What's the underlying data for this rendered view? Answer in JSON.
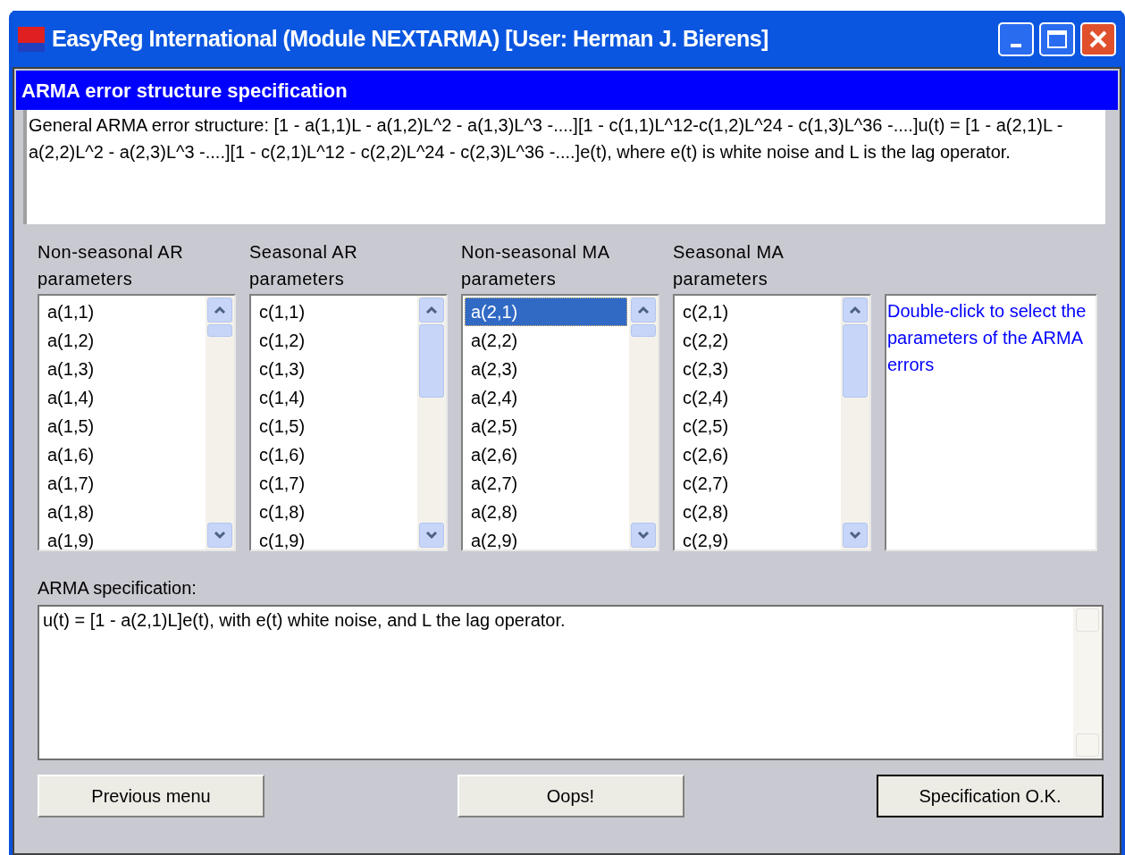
{
  "window": {
    "title": "EasyReg International (Module NEXTARMA) [User: Herman J. Bierens]"
  },
  "header": "ARMA error structure specification",
  "description": "General ARMA error structure: [1 - a(1,1)L - a(1,2)L^2 - a(1,3)L^3 -....][1 - c(1,1)L^12-c(1,2)L^24 - c(1,3)L^36 -....]u(t) = [1 - a(2,1)L - a(2,2)L^2 - a(2,3)L^3 -....][1 - c(2,1)L^12 - c(2,2)L^24 - c(2,3)L^36 -....]e(t), where e(t) is white noise and L is the lag operator.",
  "lists": [
    {
      "label": "Non-seasonal AR parameters",
      "items": [
        {
          "text": "a(1,1)",
          "selected": false
        },
        {
          "text": "a(1,2)",
          "selected": false
        },
        {
          "text": "a(1,3)",
          "selected": false
        },
        {
          "text": "a(1,4)",
          "selected": false
        },
        {
          "text": "a(1,5)",
          "selected": false
        },
        {
          "text": "a(1,6)",
          "selected": false
        },
        {
          "text": "a(1,7)",
          "selected": false
        },
        {
          "text": "a(1,8)",
          "selected": false
        },
        {
          "text": "a(1,9)",
          "selected": false
        }
      ]
    },
    {
      "label": "Seasonal  AR parameters",
      "items": [
        {
          "text": "c(1,1)",
          "selected": false
        },
        {
          "text": "c(1,2)",
          "selected": false
        },
        {
          "text": "c(1,3)",
          "selected": false
        },
        {
          "text": "c(1,4)",
          "selected": false
        },
        {
          "text": "c(1,5)",
          "selected": false
        },
        {
          "text": "c(1,6)",
          "selected": false
        },
        {
          "text": "c(1,7)",
          "selected": false
        },
        {
          "text": "c(1,8)",
          "selected": false
        },
        {
          "text": "c(1,9)",
          "selected": false
        }
      ]
    },
    {
      "label": "Non-seasonal MA parameters",
      "items": [
        {
          "text": "a(2,1)",
          "selected": true
        },
        {
          "text": "a(2,2)",
          "selected": false
        },
        {
          "text": "a(2,3)",
          "selected": false
        },
        {
          "text": "a(2,4)",
          "selected": false
        },
        {
          "text": "a(2,5)",
          "selected": false
        },
        {
          "text": "a(2,6)",
          "selected": false
        },
        {
          "text": "a(2,7)",
          "selected": false
        },
        {
          "text": "a(2,8)",
          "selected": false
        },
        {
          "text": "a(2,9)",
          "selected": false
        }
      ]
    },
    {
      "label": "Seasonal MA parameters",
      "items": [
        {
          "text": "c(2,1)",
          "selected": false
        },
        {
          "text": "c(2,2)",
          "selected": false
        },
        {
          "text": "c(2,3)",
          "selected": false
        },
        {
          "text": "c(2,4)",
          "selected": false
        },
        {
          "text": "c(2,5)",
          "selected": false
        },
        {
          "text": "c(2,6)",
          "selected": false
        },
        {
          "text": "c(2,7)",
          "selected": false
        },
        {
          "text": "c(2,8)",
          "selected": false
        },
        {
          "text": "c(2,9)",
          "selected": false
        }
      ]
    }
  ],
  "hint": "Double-click to select the parameters of the ARMA errors",
  "specification": {
    "label": "ARMA specification:",
    "value": "u(t) = [1 - a(2,1)L]e(t), with e(t) white noise, and L the lag operator."
  },
  "buttons": [
    {
      "label": "Previous menu",
      "default": false
    },
    {
      "label": "Oops!",
      "default": false
    },
    {
      "label": "Specification O.K.",
      "default": true
    }
  ]
}
